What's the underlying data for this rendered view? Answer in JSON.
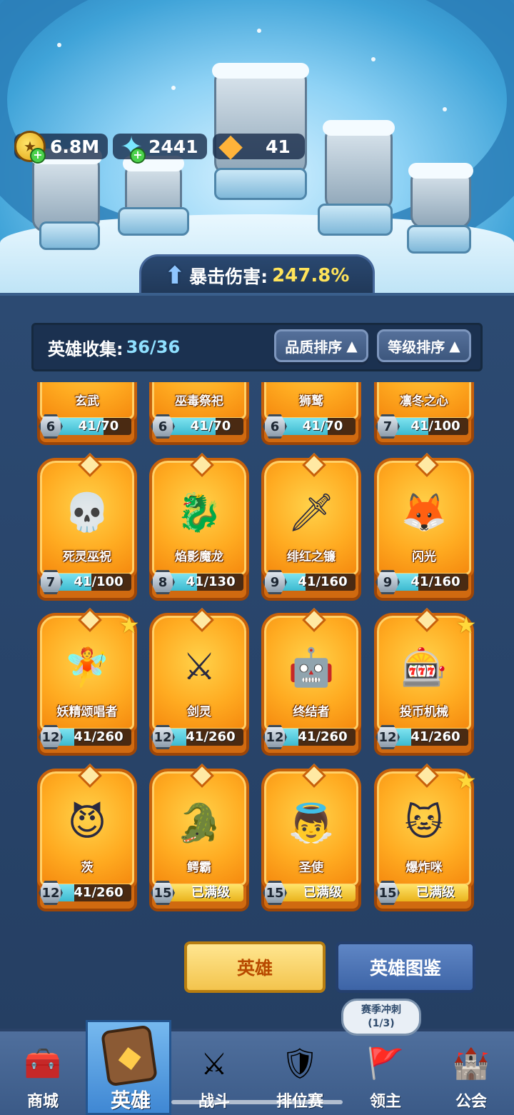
{
  "resources": {
    "gold": "6.8M",
    "gems": "2441",
    "crystals": "41"
  },
  "crit": {
    "label": "暴击伤害:",
    "value": "247.8%"
  },
  "collection": {
    "label": "英雄收集:",
    "value": "36/36",
    "sort_quality": "品质排序",
    "sort_level": "等级排序"
  },
  "heroes": [
    {
      "name": "玄武",
      "level": "6",
      "progress": "41/70",
      "fill": 0.59,
      "icon": "turtle-icon",
      "glyph": "🐢",
      "star": false
    },
    {
      "name": "巫毒祭祀",
      "level": "6",
      "progress": "41/70",
      "fill": 0.59,
      "icon": "voodoo-icon",
      "glyph": "🎭",
      "star": false
    },
    {
      "name": "狮鹫",
      "level": "6",
      "progress": "41/70",
      "fill": 0.59,
      "icon": "griffin-icon",
      "glyph": "🦅",
      "star": false
    },
    {
      "name": "凛冬之心",
      "level": "7",
      "progress": "41/100",
      "fill": 0.41,
      "icon": "snowflake-icon",
      "glyph": "❄",
      "star": false
    },
    {
      "name": "死灵巫祝",
      "level": "7",
      "progress": "41/100",
      "fill": 0.41,
      "icon": "skull-icon",
      "glyph": "💀",
      "star": false
    },
    {
      "name": "焰影魔龙",
      "level": "8",
      "progress": "41/130",
      "fill": 0.32,
      "icon": "dragon-icon",
      "glyph": "🐉",
      "star": false
    },
    {
      "name": "绯红之镰",
      "level": "9",
      "progress": "41/160",
      "fill": 0.26,
      "icon": "scythe-icon",
      "glyph": "🗡",
      "star": false
    },
    {
      "name": "闪光",
      "level": "9",
      "progress": "41/160",
      "fill": 0.26,
      "icon": "fox-icon",
      "glyph": "🦊",
      "star": false
    },
    {
      "name": "妖精颂唱者",
      "level": "12",
      "progress": "41/260",
      "fill": 0.16,
      "icon": "fairy-icon",
      "glyph": "🧚",
      "star": true
    },
    {
      "name": "剑灵",
      "level": "12",
      "progress": "41/260",
      "fill": 0.16,
      "icon": "sword-spirit-icon",
      "glyph": "⚔",
      "star": false
    },
    {
      "name": "终结者",
      "level": "12",
      "progress": "41/260",
      "fill": 0.16,
      "icon": "terminator-icon",
      "glyph": "🤖",
      "star": false
    },
    {
      "name": "投币机械",
      "level": "12",
      "progress": "41/260",
      "fill": 0.16,
      "icon": "slot-machine-icon",
      "glyph": "🎰",
      "star": true
    },
    {
      "name": "茨",
      "level": "12",
      "progress": "41/260",
      "fill": 0.16,
      "icon": "demon-girl-icon",
      "glyph": "😈",
      "star": false
    },
    {
      "name": "鳄霸",
      "level": "15",
      "progress": "已满级",
      "fill": 1.0,
      "icon": "crocodile-icon",
      "glyph": "🐊",
      "star": false
    },
    {
      "name": "圣使",
      "level": "15",
      "progress": "已满级",
      "fill": 1.0,
      "icon": "angel-icon",
      "glyph": "👼",
      "star": false
    },
    {
      "name": "爆炸咪",
      "level": "15",
      "progress": "已满级",
      "fill": 1.0,
      "icon": "cat-icon",
      "glyph": "🐱",
      "star": true
    }
  ],
  "buttons": {
    "hero": "英雄",
    "codex": "英雄图鉴"
  },
  "season": {
    "title": "赛季冲刺",
    "count": "(1/3)"
  },
  "nav": [
    {
      "label": "商城",
      "icon": "shop-chest-icon",
      "glyph": "🧰"
    },
    {
      "label": "英雄",
      "icon": "hero-card-icon",
      "glyph": "◆"
    },
    {
      "label": "战斗",
      "icon": "crossed-swords-icon",
      "glyph": "⚔"
    },
    {
      "label": "排位赛",
      "icon": "ranked-shield-icon",
      "glyph": "🛡"
    },
    {
      "label": "领主",
      "icon": "lord-banner-icon",
      "glyph": "🚩"
    },
    {
      "label": "公会",
      "icon": "guild-castle-icon",
      "glyph": "🏰"
    }
  ],
  "colors": {
    "card_orange": "#ffab21",
    "progress_cyan": "#3cbad0",
    "progress_max": "#e9b31c",
    "crit_value": "#ffe35a"
  }
}
